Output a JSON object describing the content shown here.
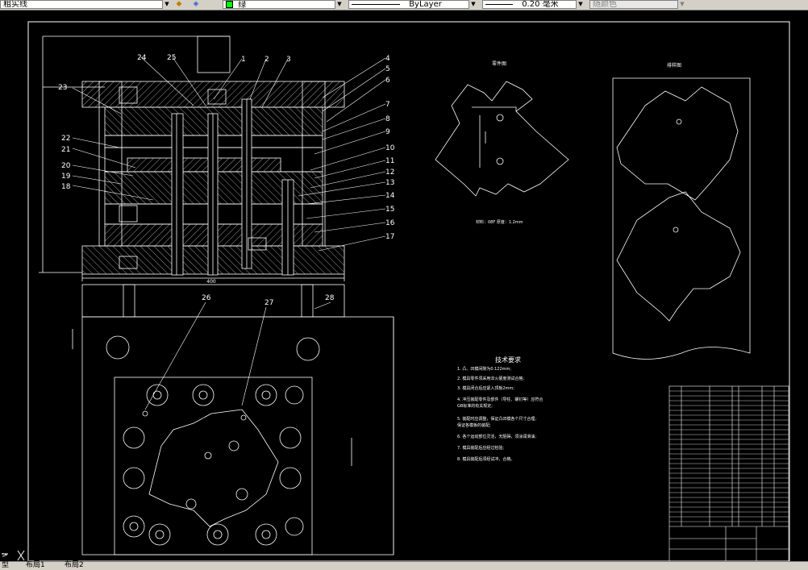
{
  "toolbar": {
    "layer_value": "粗实线",
    "color_value": "绿",
    "linetype_value": "ByLayer",
    "lineweight_value": "0.20 毫米",
    "plotstyle_value": "随颜色"
  },
  "tabs": [
    "型",
    "布局1",
    "布局2"
  ],
  "drawing": {
    "part_numbers_left": [
      "23",
      "22",
      "21",
      "20",
      "19",
      "18"
    ],
    "part_numbers_top": [
      "24",
      "25",
      "1",
      "2",
      "3"
    ],
    "part_numbers_right": [
      "4",
      "5",
      "6",
      "7",
      "8",
      "9",
      "10",
      "11",
      "12",
      "13",
      "14",
      "15",
      "16",
      "17"
    ],
    "part_numbers_bottom": [
      "26",
      "27",
      "28"
    ],
    "dim_width": "400",
    "part_view_title": "零件图",
    "layout_view_title": "排样图",
    "material_note": "材料：08F   厚度：1.2mm",
    "tech_title": "技术要求",
    "tech_items": [
      "1. 凸、凹模间隙为0.122mm;",
      "2. 模具零件须采用淬火硬度测试合格;",
      "3. 模具闭合后应紧入顶板2mm;",
      "4. 冲压装配零件及部件（导柱、螺钉等）应符合",
      "   GB标准的有关规定;",
      "5. 装配时应调整，保证凸凹模各个尺寸合理;",
      "   保证各模板的装配;",
      "6. 各个运动部位灵活，无阻碍，须涂润滑油;",
      "7. 模具装配后应经过检验;",
      "8. 模具装配后须经试冲，合格。"
    ]
  }
}
